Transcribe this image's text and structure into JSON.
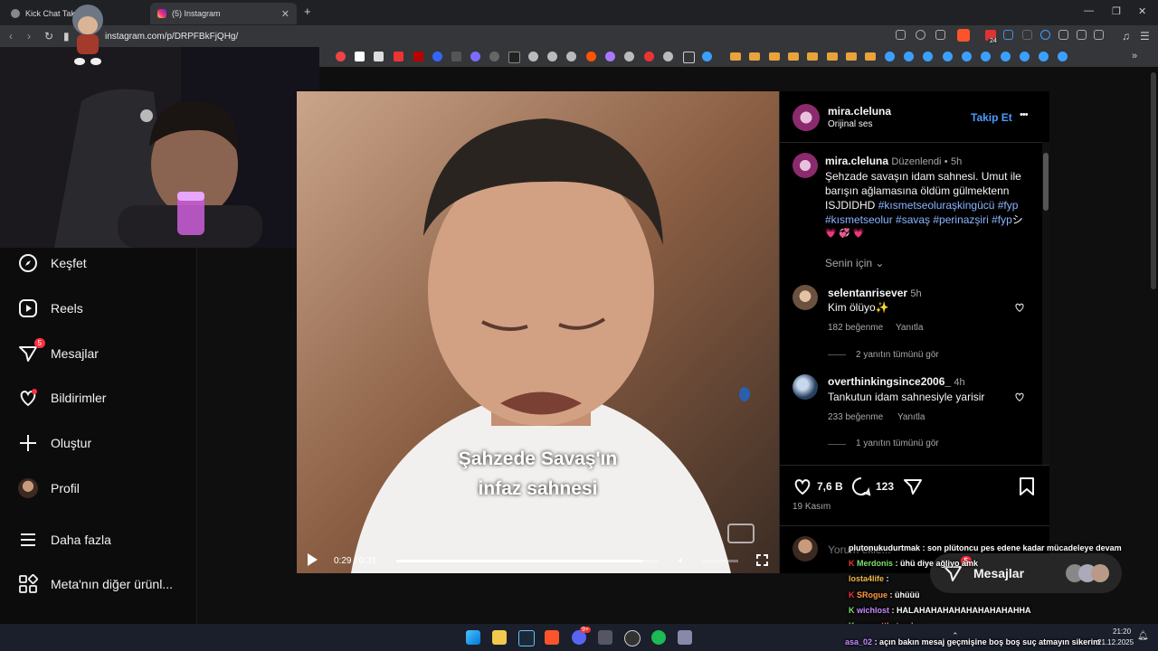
{
  "browser": {
    "tabs": [
      {
        "label": "Kick Chat Takip |"
      },
      {
        "label": "(5) Instagram"
      }
    ],
    "url": "instagram.com/p/DRPFBkFjQHg/",
    "new_tab_label": "+",
    "bookmark_badge": "24"
  },
  "sidebar": {
    "items": [
      {
        "label": "Keşfet",
        "icon": "compass-icon"
      },
      {
        "label": "Reels",
        "icon": "reels-icon"
      },
      {
        "label": "Mesajlar",
        "icon": "messenger-icon",
        "badge": "5"
      },
      {
        "label": "Bildirimler",
        "icon": "heart-icon"
      },
      {
        "label": "Oluştur",
        "icon": "plus-icon"
      },
      {
        "label": "Profil",
        "icon": "avatar"
      },
      {
        "label": "Daha fazla",
        "icon": "menu-icon"
      },
      {
        "label": "Meta'nın diğer ürünl...",
        "icon": "grid-icon"
      }
    ]
  },
  "video": {
    "subtitle_line1": "Şahzede Savaş'ın",
    "subtitle_line2": "infaz sahnesi",
    "time": "0:29 / 0:31",
    "progress": 0.94
  },
  "post": {
    "author": "mira.cleluna",
    "audio": "Orijinal ses",
    "follow_label": "Takip Et",
    "more_label": "•••",
    "caption": {
      "author": "mira.cleluna",
      "edited": "Düzenlendi",
      "time": "5h",
      "line1": "Şehzade savaşın idam sahnesi. Umut ile",
      "line2": "barışın ağlamasına öldüm gülmektenn",
      "line3_text": "ISJDIDHD",
      "line3_tags": "#kısmetseoluraşkingücü #fyp",
      "line4_tags": "#kısmetseolur #savaş #perinazşiri #fyp",
      "line4_tail": "シ",
      "emojis": "💗 💞 💗"
    },
    "for_you": "Senin için",
    "comments": [
      {
        "user": "selentanrisever",
        "time": "5h",
        "text": "Kim ölüyo✨",
        "likes": "182 beğenme",
        "reply": "Yanıtla",
        "view_replies": "2 yanıtın tümünü gör"
      },
      {
        "user": "overthinkingsince2006_",
        "time": "4h",
        "text": "Tankutun idam sahnesiyle yarisir",
        "likes": "233 beğenme",
        "reply": "Yanıtla",
        "view_replies": "1 yanıtın tümünü gör"
      }
    ],
    "like_count": "7,6 B",
    "comment_count": "123",
    "date": "19 Kasım",
    "comment_placeholder": "Yorum ekle..."
  },
  "messages_pill": {
    "label": "Mesajlar",
    "badge": "5"
  },
  "chat": [
    {
      "user": "plutonukudurtmak",
      "text": ": son plütoncu pes edene kadar mücadeleye devam",
      "color": "#ffffff"
    },
    {
      "user": "Merdonis",
      "text": ": ühü diye ağliyo amk",
      "color": "#7fe06a"
    },
    {
      "user": "losta4life",
      "text": ":",
      "color": "#f2b84b"
    },
    {
      "user": "SRogue",
      "text": ": ühüüü",
      "color": "#ff9a3d"
    },
    {
      "user": "wichlost",
      "text": ": HALAHAHAHAHAHAHAHAHAHHA",
      "color": "#c58bff"
    },
    {
      "user": "zumrutthetrash",
      "text": ":",
      "color": "#ff7a8a"
    },
    {
      "user": "asa_02",
      "text": ": açın bakın mesaj geçmişine boş boş suç atmayın sikerim",
      "color": "#c58bff"
    }
  ],
  "taskbar": {
    "time": "21:20",
    "date": "21.12.2025",
    "discord_badge": "9+"
  }
}
